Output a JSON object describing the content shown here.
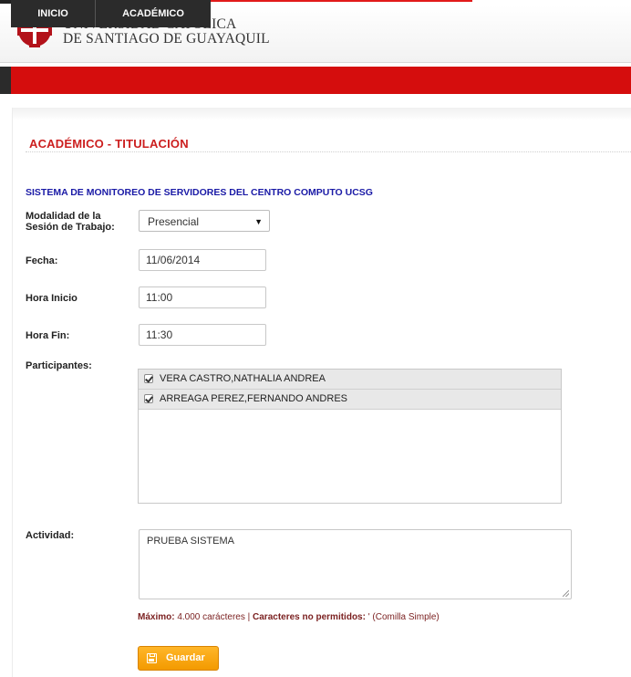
{
  "header": {
    "university_line1": "UNIVERSIDAD CATÓLICA",
    "university_line2": "DE SANTIAGO DE GUAYAQUIL",
    "logo_icon": "university-cross-logo",
    "brand_color": "#d50d0d"
  },
  "nav": {
    "items": [
      {
        "label": "INICIO"
      },
      {
        "label": "ACADÉMICO"
      }
    ]
  },
  "page": {
    "section_title": "ACADÉMICO - TITULACIÓN",
    "system_title": "SISTEMA DE MONITOREO DE SERVIDORES DEL CENTRO COMPUTO UCSG"
  },
  "form": {
    "modalidad": {
      "label_line1": "Modalidad de la",
      "label_line2": "Sesión de Trabajo:",
      "selected": "Presencial"
    },
    "fecha": {
      "label": "Fecha:",
      "value": "11/06/2014"
    },
    "hora_inicio": {
      "label": "Hora Inicio",
      "value": "11:00"
    },
    "hora_fin": {
      "label": "Hora Fin:",
      "value": "11:30"
    },
    "participantes": {
      "label": "Participantes:",
      "items": [
        {
          "name": "VERA CASTRO,NATHALIA ANDREA",
          "checked": true
        },
        {
          "name": "ARREAGA PEREZ,FERNANDO ANDRES",
          "checked": true
        }
      ]
    },
    "actividad": {
      "label": "Actividad:",
      "value": "PRUEBA SISTEMA"
    },
    "hint": {
      "max_label": "Máximo:",
      "max_value": "4.000 carácteres",
      "separator": "|",
      "forbidden_label": "Caracteres no permitidos:",
      "forbidden_value": "' (Comilla Simple)"
    },
    "save_label": "Guardar"
  }
}
